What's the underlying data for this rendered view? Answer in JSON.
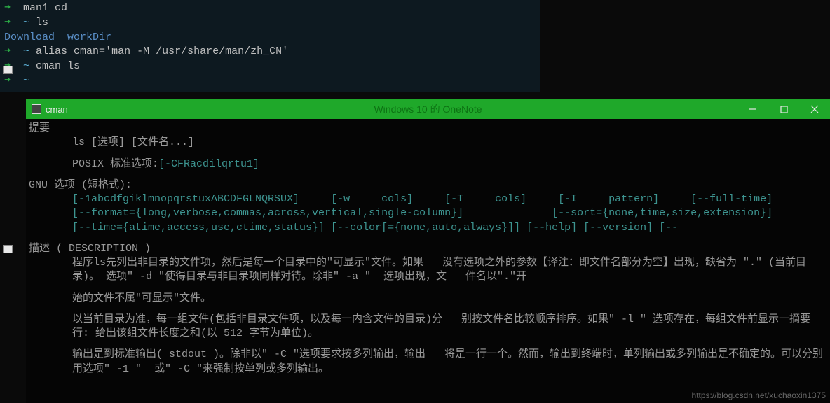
{
  "terminal": {
    "l1_arrow": "➜",
    "l1_cmd": "  man1 cd",
    "l2_arrow": "➜",
    "l2_loc": "  ~ ",
    "l2_cmd": "ls",
    "l3": "Download  workDir",
    "l4_arrow": "➜",
    "l4_loc": "  ~ ",
    "l4_cmd": "alias cman='man -M /usr/share/man/zh_CN'",
    "l5_arrow": "➜",
    "l5_loc": "  ~ ",
    "l5_cmd": "cman ls",
    "l6_arrow": "➜",
    "l6_loc": "  ~ "
  },
  "window": {
    "title": "cman",
    "faded": "Windows 10 的 OneNote"
  },
  "man": {
    "synopsis": "提要",
    "usage": "ls [选项] [文件名...]",
    "posix_label": "POSIX 标准选项:",
    "posix_opts": "[-CFRacdilqrtu1]",
    "gnu_label": "GNU 选项 (短格式):",
    "gnu_line1_opt": "[-1abcdfgiklmnopqrstuxABCDFGLNQRSUX]",
    "gnu_line1_rest": "     [-w     cols]     [-T     cols]     [-I     pattern]     [--full-time]",
    "gnu_line2": "[--format={long,verbose,commas,across,vertical,single-column}]              [--sort={none,time,size,extension}]",
    "gnu_line3": "[--time={atime,access,use,ctime,status}] [--color[={none,auto,always}]] [--help] [--version] [--",
    "desc_label": "描述 ( DESCRIPTION )",
    "desc_p1": "程序ls先列出非目录的文件项，然后是每一个目录中的\"可显示\"文件。如果   没有选项之外的参数【译注：即文件名部分为空】出现，缺省为 \".\" (当前目录)。 选项\" -d \"使得目录与非目录项同样对待。除非\" -a \"  选项出现，文   件名以\".\"开",
    "desc_p2": "始的文件不属\"可显示\"文件。",
    "desc_p3": "以当前目录为准，每一组文件(包括非目录文件项，以及每一内含文件的目录)分   别按文件名比较顺序排序。如果\" -l \" 选项存在，每组文件前显示一摘要行: 给出该组文件长度之和(以 512 字节为单位)。",
    "desc_p4": "输出是到标准输出( stdout )。除非以\" -C \"选项要求按多列输出，输出   将是一行一个。然而，输出到终端时，单列输出或多列输出是不确定的。可以分别 用选项\" -1 \"  或\" -C \"来强制按单列或多列输出。"
  },
  "watermark": "https://blog.csdn.net/xuchaoxin1375"
}
